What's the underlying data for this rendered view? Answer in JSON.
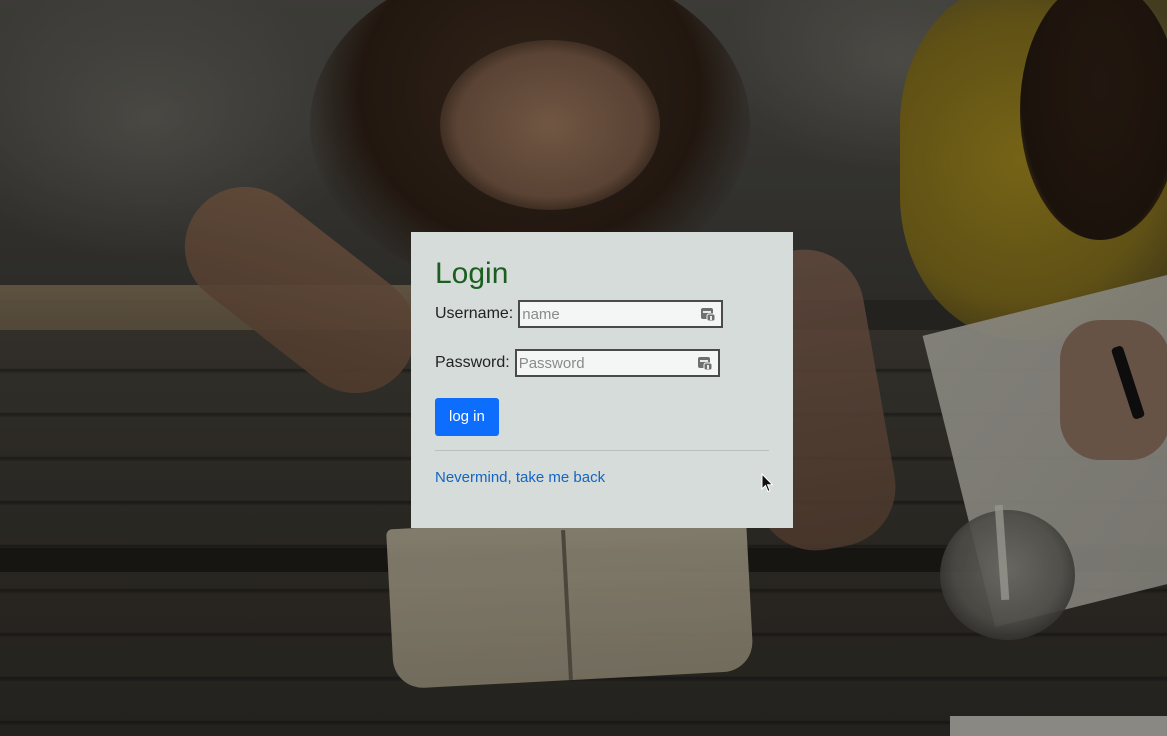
{
  "login": {
    "title": "Login",
    "username_label": "Username:",
    "username_placeholder": "name",
    "username_value": "",
    "password_label": "Password:",
    "password_placeholder": "Password",
    "password_value": "",
    "submit_label": "log in",
    "back_link": "Nevermind, take me back"
  },
  "icons": {
    "field_icon": "password-manager-icon",
    "cursor": "mouse-pointer-icon"
  },
  "colors": {
    "title": "#1b5e20",
    "button": "#0d6efd",
    "link": "#1565c0",
    "card_background": "#d6dcd9"
  }
}
